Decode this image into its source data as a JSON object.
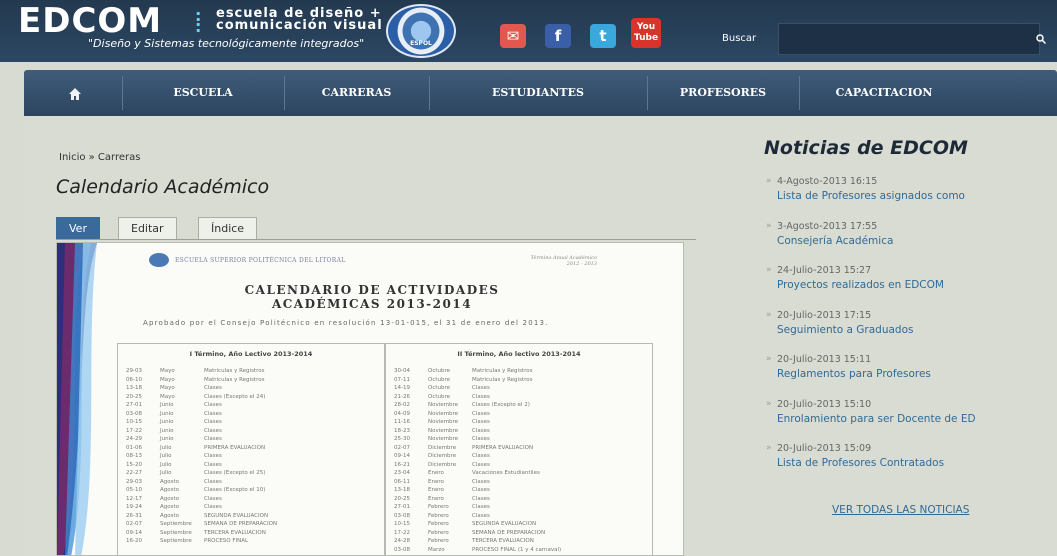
{
  "header": {
    "logo": "EDCOM",
    "logo_sub_1": "escuela de diseño +",
    "logo_sub_2": "comunicación visual",
    "tagline": "\"Diseño y Sistemas tecnológicamente integrados\"",
    "seal_text": "ESPOL",
    "search_label": "Buscar",
    "search_placeholder": "",
    "social": {
      "mail": "✉",
      "facebook": "f",
      "twitter": "t",
      "youtube": "You Tube"
    }
  },
  "nav": {
    "items": [
      "ESCUELA",
      "CARRERAS",
      "ESTUDIANTES",
      "PROFESORES",
      "CAPACITACION"
    ]
  },
  "breadcrumb": "Inicio » Carreras",
  "page_title": "Calendario Académico",
  "tabs": [
    "Ver",
    "Editar",
    "Índice"
  ],
  "document": {
    "institution": "ESCUELA SUPERIOR POLITÉCNICA DEL LITORAL",
    "year_note": "Término Anual Académico 2012 - 2013",
    "title_1": "CALENDARIO DE ACTIVIDADES",
    "title_2": "ACADÉMICAS 2013-2014",
    "approved": "Aprobado por el Consejo Politécnico en resolución 13-01-015, el 31 de enero del 2013.",
    "term1": {
      "heading": "I Término, Año Lectivo 2013-2014",
      "rows": [
        [
          "29-03",
          "Mayo",
          "Matrículas y Registros"
        ],
        [
          "06-10",
          "Mayo",
          "Matrículas y Registros"
        ],
        [
          "13-18",
          "Mayo",
          "Clases"
        ],
        [
          "20-25",
          "Mayo",
          "Clases (Excepto el 24)"
        ],
        [
          "27-01",
          "Junio",
          "Clases"
        ],
        [
          "03-08",
          "Junio",
          "Clases"
        ],
        [
          "10-15",
          "Junio",
          "Clases"
        ],
        [
          "17-22",
          "Junio",
          "Clases"
        ],
        [
          "24-29",
          "Junio",
          "Clases"
        ],
        [
          "01-06",
          "Julio",
          "PRIMERA EVALUACIÓN"
        ],
        [
          "08-13",
          "Julio",
          "Clases"
        ],
        [
          "15-20",
          "Julio",
          "Clases"
        ],
        [
          "22-27",
          "Julio",
          "Clases (Excepto el 25)"
        ],
        [
          "29-03",
          "Agosto",
          "Clases"
        ],
        [
          "05-10",
          "Agosto",
          "Clases (Excepto el 10)"
        ],
        [
          "12-17",
          "Agosto",
          "Clases"
        ],
        [
          "19-24",
          "Agosto",
          "Clases"
        ],
        [
          "26-31",
          "Agosto",
          "SEGUNDA EVALUACIÓN"
        ],
        [
          "02-07",
          "Septiembre",
          "SEMANA DE PREPARACIÓN"
        ],
        [
          "09-14",
          "Septiembre",
          "TERCERA EVALUACIÓN"
        ],
        [
          "16-20",
          "Septiembre",
          "PROCESO FINAL"
        ]
      ]
    },
    "term2": {
      "heading": "II Término, Año lectivo 2013-2014",
      "rows": [
        [
          "30-04",
          "Octubre",
          "Matrículas y Registros"
        ],
        [
          "07-11",
          "Octubre",
          "Matrículas y Registros"
        ],
        [
          "14-19",
          "Octubre",
          "Clases"
        ],
        [
          "21-26",
          "Octubre",
          "Clases"
        ],
        [
          "28-02",
          "Noviembre",
          "Clases (Excepto el 2)"
        ],
        [
          "04-09",
          "Noviembre",
          "Clases"
        ],
        [
          "11-16",
          "Noviembre",
          "Clases"
        ],
        [
          "18-23",
          "Noviembre",
          "Clases"
        ],
        [
          "25-30",
          "Noviembre",
          "Clases"
        ],
        [
          "02-07",
          "Diciembre",
          "PRIMERA EVALUACIÓN"
        ],
        [
          "09-14",
          "Diciembre",
          "Clases"
        ],
        [
          "16-21",
          "Diciembre",
          "Clases"
        ],
        [
          "23-04",
          "Enero",
          "Vacaciones Estudiantiles"
        ],
        [
          "06-11",
          "Enero",
          "Clases"
        ],
        [
          "13-18",
          "Enero",
          "Clases"
        ],
        [
          "20-25",
          "Enero",
          "Clases"
        ],
        [
          "27-01",
          "Febrero",
          "Clases"
        ],
        [
          "03-08",
          "Febrero",
          "Clases"
        ],
        [
          "10-15",
          "Febrero",
          "SEGUNDA EVALUACIÓN"
        ],
        [
          "17-22",
          "Febrero",
          "SEMANA DE PREPARACIÓN"
        ],
        [
          "24-28",
          "Febrero",
          "TERCERA EVALUACIÓN"
        ],
        [
          "03-08",
          "Marzo",
          "PROCESO FINAL (1 y 4 carnaval)"
        ]
      ]
    }
  },
  "news": {
    "title": "Noticias de EDCOM",
    "items": [
      {
        "date": "4-Agosto-2013 16:15",
        "link": "Lista de Profesores asignados como"
      },
      {
        "date": "3-Agosto-2013 17:55",
        "link": "Consejería Académica"
      },
      {
        "date": "24-Julio-2013 15:27",
        "link": "Proyectos realizados en EDCOM"
      },
      {
        "date": "20-Julio-2013 17:15",
        "link": "Seguimiento a Graduados"
      },
      {
        "date": "20-Julio-2013 15:11",
        "link": "Reglamentos para Profesores"
      },
      {
        "date": "20-Julio-2013 15:10",
        "link": "Enrolamiento para ser Docente de ED"
      },
      {
        "date": "20-Julio-2013 15:09",
        "link": "Lista de Profesores Contratados"
      }
    ],
    "all_link": "VER TODAS LAS NOTICIAS"
  }
}
